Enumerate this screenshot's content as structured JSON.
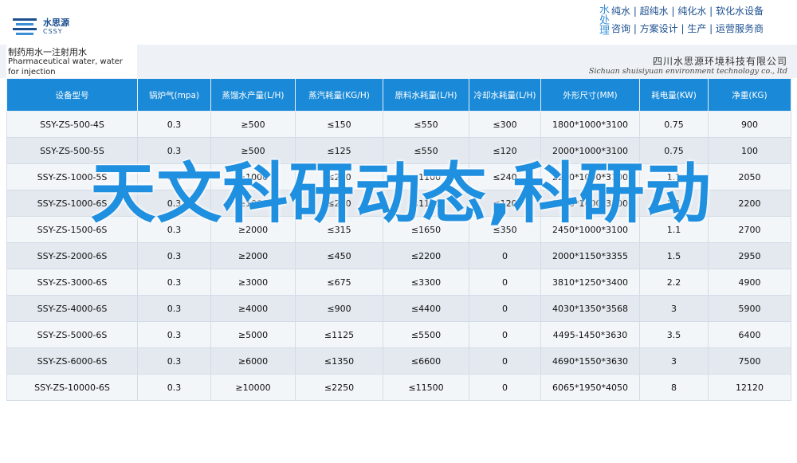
{
  "header": {
    "logo": {
      "name": "水思源",
      "en": "CSSY"
    },
    "slogan": {
      "side": "水处理",
      "line1": "纯水 | 超纯水 | 纯化水 | 软化水设备",
      "line2": "咨询 | 方案设计 | 生产 | 运营服务商"
    },
    "product_title_cn": "制药用水一注射用水",
    "product_title_en": "Pharmaceutical water, water for injection",
    "company_cn": "四川水思源环境科技有限公司",
    "company_en": "Sichuan shuisiyuan environment technology co., ltd"
  },
  "table": {
    "columns": [
      "设备型号",
      "锅炉气(mpa)",
      "蒸馏水产量(L/H)",
      "蒸汽耗量(KG/H)",
      "原料水耗量(L/H)",
      "冷却水耗量(L/H)",
      "外形尺寸(MM)",
      "耗电量(KW)",
      "净重(KG)"
    ],
    "rows": [
      [
        "SSY-ZS-500-4S",
        "0.3",
        "≥500",
        "≤150",
        "≤550",
        "≤300",
        "1800*1000*3100",
        "0.75",
        "900"
      ],
      [
        "SSY-ZS-500-5S",
        "0.3",
        "≥500",
        "≤125",
        "≤550",
        "≤120",
        "2000*1000*3100",
        "0.75",
        "100"
      ],
      [
        "SSY-ZS-1000-5S",
        "0.3",
        "≥1000",
        "≤250",
        "≤1100",
        "≤240",
        "2200*1000*3100",
        "1.1",
        "2050"
      ],
      [
        "SSY-ZS-1000-6S",
        "0.3",
        "≥1000",
        "≤210",
        "≤1100",
        "≤120",
        "2300*1000*3100",
        "1.1",
        "2200"
      ],
      [
        "SSY-ZS-1500-6S",
        "0.3",
        "≥2000",
        "≤315",
        "≤1650",
        "≤350",
        "2450*1000*3100",
        "1.1",
        "2700"
      ],
      [
        "SSY-ZS-2000-6S",
        "0.3",
        "≥2000",
        "≤450",
        "≤2200",
        "0",
        "2000*1150*3355",
        "1.5",
        "2950"
      ],
      [
        "SSY-ZS-3000-6S",
        "0.3",
        "≥3000",
        "≤675",
        "≤3300",
        "0",
        "3810*1250*3400",
        "2.2",
        "4900"
      ],
      [
        "SSY-ZS-4000-6S",
        "0.3",
        "≥4000",
        "≤900",
        "≤4400",
        "0",
        "4030*1350*3568",
        "3",
        "5900"
      ],
      [
        "SSY-ZS-5000-6S",
        "0.3",
        "≥5000",
        "≤1125",
        "≤5500",
        "0",
        "4495-1450*3630",
        "3.5",
        "6400"
      ],
      [
        "SSY-ZS-6000-6S",
        "0.3",
        "≥6000",
        "≤1350",
        "≤6600",
        "0",
        "4690*1550*3630",
        "3",
        "7500"
      ],
      [
        "SSY-ZS-10000-6S",
        "0.3",
        "≥10000",
        "≤2250",
        "≤11500",
        "0",
        "6065*1950*4050",
        "8",
        "12120"
      ]
    ]
  },
  "overlay": {
    "title": "天文科研动态,科研动"
  },
  "colors": {
    "header_blue": "#1a8ad8",
    "overlay_blue": "#1f8fe0",
    "brand_navy": "#1b4f8f"
  }
}
